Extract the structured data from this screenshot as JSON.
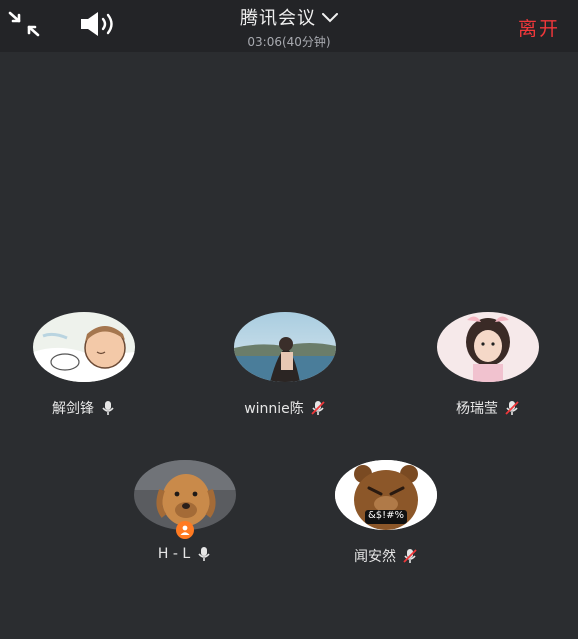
{
  "header": {
    "title": "腾讯会议",
    "timer": "03:06(40分钟)",
    "leave_label": "离开",
    "icons": {
      "shrink": "exit-fullscreen-icon",
      "speaker": "speaker-icon",
      "dropdown": "chevron-down-icon"
    }
  },
  "participants": [
    {
      "name": "解剑锋",
      "mic": "on",
      "avatar": "cartoon-sleeping-avatar"
    },
    {
      "name": "winnie陈",
      "mic": "muted",
      "avatar": "lake-photo-avatar"
    },
    {
      "name": "杨瑞莹",
      "mic": "muted",
      "avatar": "child-photo-avatar"
    },
    {
      "name": "H - L",
      "mic": "on",
      "avatar": "dog-photo-avatar",
      "host": true
    },
    {
      "name": "闻安然",
      "mic": "muted",
      "avatar": "bear-emoji-avatar",
      "avatar_text": "&$!#%"
    }
  ],
  "colors": {
    "leave": "#f0373a",
    "host_badge": "#ff7a21",
    "background": "#2b2d30"
  }
}
